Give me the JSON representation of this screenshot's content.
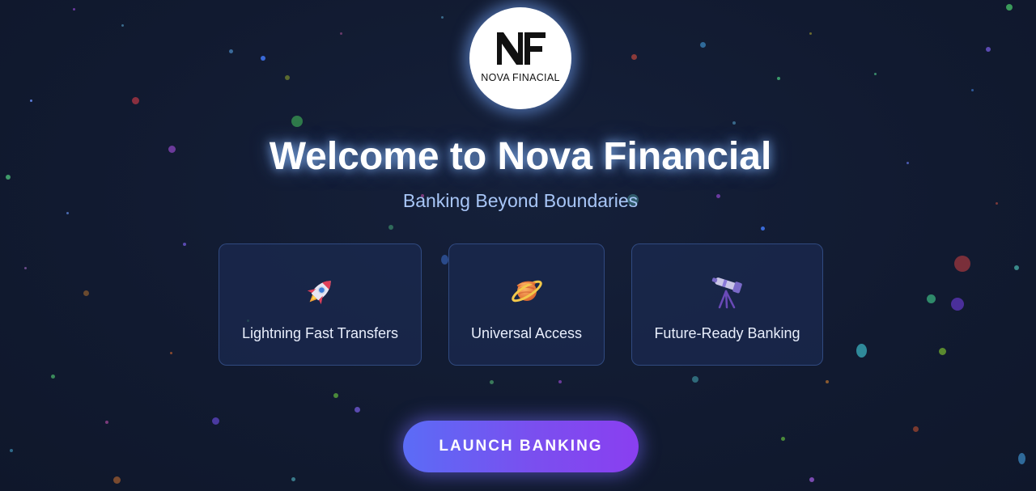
{
  "logo": {
    "monogram": "NF",
    "text": "NOVA FINACIAL"
  },
  "hero": {
    "title": "Welcome to Nova Financial",
    "subtitle": "Banking Beyond Boundaries"
  },
  "features": [
    {
      "label": "Lightning Fast Transfers",
      "icon": "rocket-icon"
    },
    {
      "label": "Universal Access",
      "icon": "ringed-planet-icon"
    },
    {
      "label": "Future-Ready Banking",
      "icon": "telescope-icon"
    }
  ],
  "cta": {
    "label": "LAUNCH BANKING"
  },
  "colors": {
    "background": "#111a30",
    "accent_start": "#5b6cf6",
    "accent_end": "#8a3ff0",
    "subtitle": "#a8c6f7"
  }
}
